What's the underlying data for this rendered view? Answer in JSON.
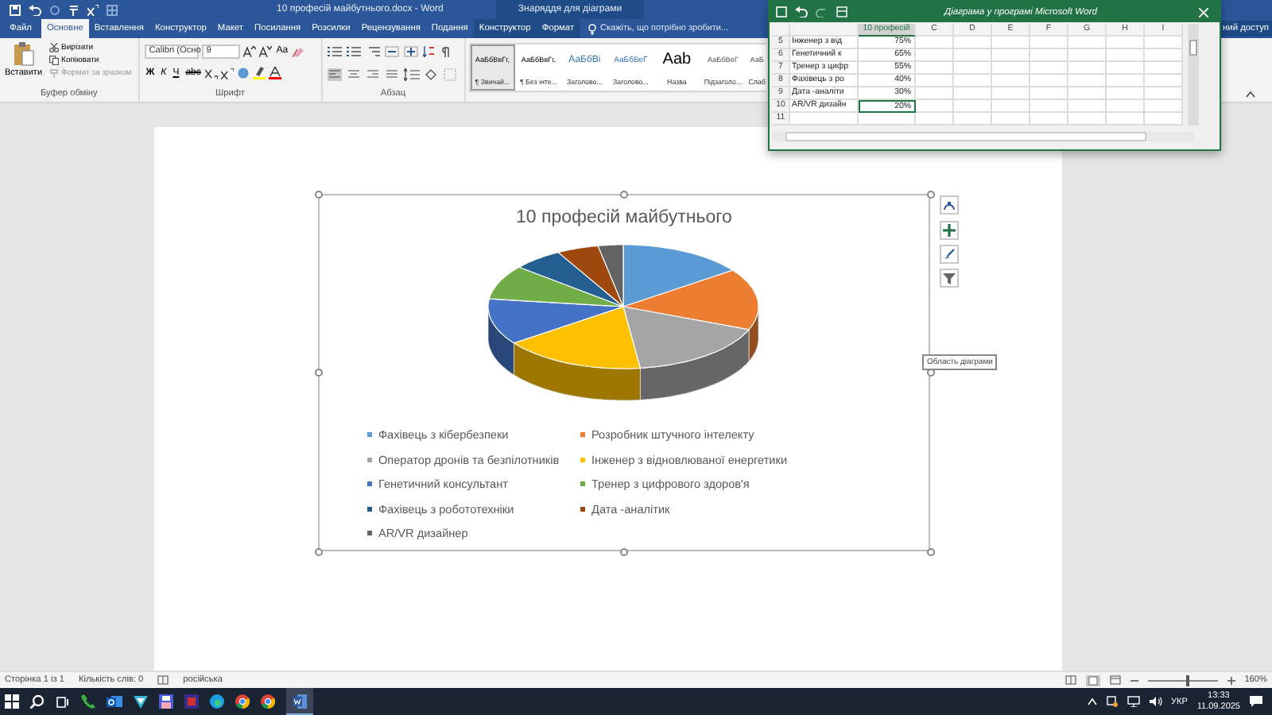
{
  "title_bar": {
    "title": "10 професій майбутнього.docx - Word",
    "context_header": "Знаряддя для діаграми"
  },
  "tabs": [
    {
      "label": "Файл",
      "selected": false,
      "kind": "file"
    },
    {
      "label": "Основне",
      "selected": true,
      "kind": "normal"
    },
    {
      "label": "Вставлення",
      "selected": false,
      "kind": "normal"
    },
    {
      "label": "Конструктор",
      "selected": false,
      "kind": "normal"
    },
    {
      "label": "Макет",
      "selected": false,
      "kind": "normal"
    },
    {
      "label": "Посилання",
      "selected": false,
      "kind": "normal"
    },
    {
      "label": "Розсилки",
      "selected": false,
      "kind": "normal"
    },
    {
      "label": "Рецензування",
      "selected": false,
      "kind": "normal"
    },
    {
      "label": "Подання",
      "selected": false,
      "kind": "normal"
    },
    {
      "label": "Конструктор",
      "selected": false,
      "kind": "context"
    },
    {
      "label": "Формат",
      "selected": false,
      "kind": "context"
    }
  ],
  "tell_me": "Скажіть, що потрібно зробити...",
  "share": "ний доступ",
  "ribbon": {
    "clipboard": {
      "paste": "Вставити",
      "cut": "Вирізати",
      "copy": "Копіювати",
      "format_painter": "Формат за зразком",
      "label": "Буфер обміну"
    },
    "font": {
      "name": "Calibri (Осно",
      "size": "9",
      "case": "Aa",
      "bold": "Ж",
      "italic": "К",
      "underline": "Ч",
      "strike": "abc",
      "label": "Шрифт"
    },
    "paragraph": {
      "label": "Абзац"
    },
    "styles": [
      {
        "preview": "АаБбВвГг,",
        "name": "¶ Звичай...",
        "kind": "normal",
        "selected": true
      },
      {
        "preview": "АаБбВвГг,",
        "name": "¶ Без інте...",
        "kind": "normal",
        "selected": false
      },
      {
        "preview": "АаБбВі",
        "name": "Заголово...",
        "kind": "heading",
        "selected": false
      },
      {
        "preview": "АаБбВеГ",
        "name": "Заголово...",
        "kind": "heading2",
        "selected": false
      },
      {
        "preview": "Aab",
        "name": "Назва",
        "kind": "title",
        "selected": false
      },
      {
        "preview": "АаБбВеГ",
        "name": "Підзаголо...",
        "kind": "subtle",
        "selected": false
      },
      {
        "preview": "АаБ",
        "name": "Слаб",
        "kind": "subtle",
        "selected": false
      }
    ]
  },
  "chart": {
    "title": "10 професій майбутнього",
    "tooltip": "Область діаграми",
    "legend": [
      {
        "label": "Фахівець з кібербезпеки",
        "color": "#5b9bd5"
      },
      {
        "label": "Розробник штучного інтелекту",
        "color": "#ed7d31"
      },
      {
        "label": "Оператор дронів та безпілотників",
        "color": "#a5a5a5"
      },
      {
        "label": "Інженер з відновлюваної енергетики",
        "color": "#ffc000"
      },
      {
        "label": "Генетичний консультант",
        "color": "#4472c4"
      },
      {
        "label": "Тренер з цифрового здоров'я",
        "color": "#70ad47"
      },
      {
        "label": "Фахівець з робототехніки",
        "color": "#255e91"
      },
      {
        "label": "Дата -аналітик",
        "color": "#9e480e"
      },
      {
        "label": "AR/VR дизайнер",
        "color": "#636363"
      }
    ]
  },
  "excel": {
    "title": "Діаграма у програмі Microsoft Word",
    "columns": [
      "10 професій",
      "C",
      "D",
      "E",
      "F",
      "G",
      "H",
      "I"
    ],
    "rows": [
      {
        "number": "5",
        "name": "Інженер з від",
        "value": "75%",
        "selected": false
      },
      {
        "number": "6",
        "name": "Генетичний к",
        "value": "65%",
        "selected": false
      },
      {
        "number": "7",
        "name": "Тренер з цифр",
        "value": "55%",
        "selected": false
      },
      {
        "number": "8",
        "name": "Фахівець з ро",
        "value": "40%",
        "selected": false
      },
      {
        "number": "9",
        "name": "Дата -аналіти",
        "value": "30%",
        "selected": false
      },
      {
        "number": "10",
        "name": "AR/VR дизайн",
        "value": "20%",
        "selected": true
      },
      {
        "number": "11",
        "selected": false
      }
    ]
  },
  "status_bar": {
    "page": "Сторінка 1 із 1",
    "words": "Кількість слів: 0",
    "language": "російська",
    "zoom": "160%",
    "level": 0.57
  },
  "taskbar": {
    "language": "УКР",
    "time": "13:33",
    "date": "11.09.2025"
  }
}
